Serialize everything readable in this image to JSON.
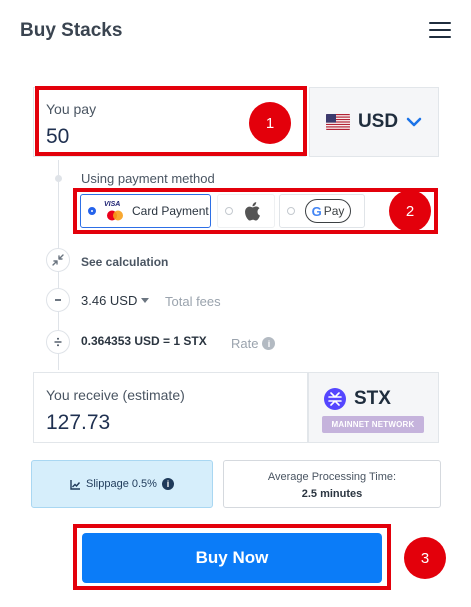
{
  "header": {
    "title": "Buy Stacks",
    "menu_icon": "hamburger-menu-icon"
  },
  "pay": {
    "label": "You pay",
    "value": "50",
    "currency": "USD",
    "flag_icon": "us-flag-icon"
  },
  "payment_method": {
    "label": "Using payment method",
    "options": [
      {
        "name": "Card Payment",
        "brand_text": "VISA",
        "icon": "visa-mastercard-icon",
        "selected": true
      },
      {
        "name": "",
        "icon": "apple-pay-icon",
        "selected": false
      },
      {
        "name": "Pay",
        "brand_text": "G",
        "icon": "google-pay-icon",
        "selected": false
      }
    ]
  },
  "calculation": {
    "label": "See calculation"
  },
  "fees": {
    "value": "3.46 USD",
    "label": "Total fees"
  },
  "rate": {
    "value": "0.364353 USD = 1 STX",
    "label": "Rate"
  },
  "receive": {
    "label": "You receive (estimate)",
    "value": "127.73",
    "token": "STX",
    "network": "MAINNET NETWORK"
  },
  "slippage": {
    "label": "Slippage 0.5%"
  },
  "processing": {
    "label": "Average Processing Time:",
    "value": "2.5 minutes"
  },
  "buy_button": {
    "label": "Buy Now"
  },
  "annotations": [
    "1",
    "2",
    "3"
  ],
  "colors": {
    "primary": "#0b7cf8",
    "annotation": "#e3000b",
    "stx": "#5546ff",
    "network_badge": "#c5b3dc"
  }
}
